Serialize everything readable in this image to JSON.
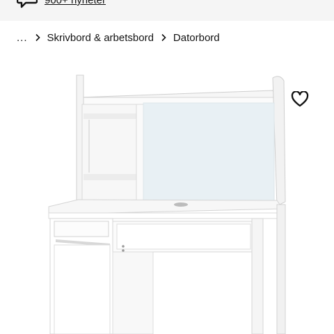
{
  "topbar": {
    "news_link": "900+ nyheter",
    "chat_icon": "speech-bubble-icon"
  },
  "breadcrumb": {
    "ellipsis": "...",
    "items": [
      {
        "label": "Skrivbord & arbetsbord"
      },
      {
        "label": "Datorbord"
      }
    ],
    "separator_icon": "chevron-right-icon"
  },
  "product": {
    "image_alt": "",
    "favourite_icon": "heart-outline-icon"
  }
}
